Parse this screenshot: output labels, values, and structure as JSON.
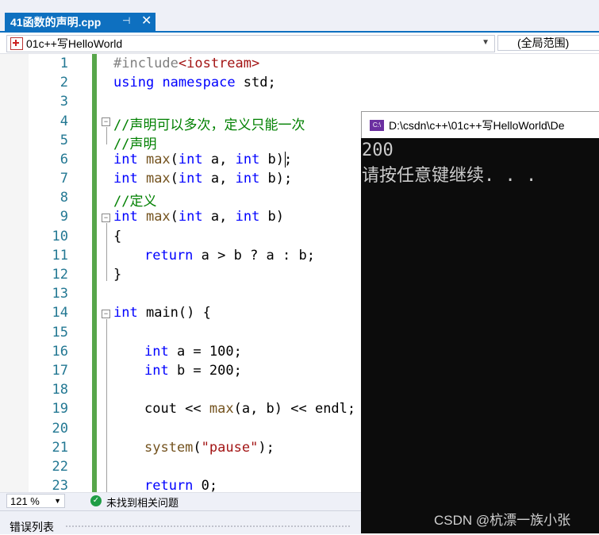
{
  "tab": {
    "title": "41函数的声明.cpp",
    "pin": "⊣",
    "close": "✕"
  },
  "navbar": {
    "project": "01c++写HelloWorld",
    "scope": "(全局范围)"
  },
  "line_numbers": [
    "1",
    "2",
    "3",
    "4",
    "5",
    "6",
    "7",
    "8",
    "9",
    "10",
    "11",
    "12",
    "13",
    "14",
    "15",
    "16",
    "17",
    "18",
    "19",
    "20",
    "21",
    "22",
    "23"
  ],
  "code": {
    "l1_directive": "#include",
    "l1_header": "<iostream>",
    "l2_using": "using",
    "l2_namespace": "namespace",
    "l2_rest": " std;",
    "l4": "//声明可以多次，定义只能一次",
    "l5": "//声明",
    "int_kw": "int",
    "l6_fn": " max",
    "l6_a": "(",
    "l6_b": " a, ",
    "l6_c": " b);",
    "l8": "//定义",
    "l9_c": " b)",
    "l10": "{",
    "l11_return": "return",
    "l11_rest": " a > b ? a : b;",
    "l12": "}",
    "l14_rest": " main() {",
    "l16_rest": " a = 100;",
    "l17_rest": " b = 200;",
    "l19_cout": "cout << ",
    "l19_fn": "max",
    "l19_rest": "(a, b) << endl;",
    "l21_fn": "system",
    "l21_open": "(",
    "l21_str": "\"pause\"",
    "l21_close": ");",
    "l23_return": "return",
    "l23_rest": " 0;"
  },
  "console": {
    "title": "D:\\csdn\\c++\\01c++写HelloWorld\\De",
    "icon": "C:\\",
    "output": [
      "200",
      "请按任意键继续. . ."
    ]
  },
  "status": {
    "zoom": "121 %",
    "issues": "未找到相关问题"
  },
  "error_panel": {
    "title": "错误列表"
  },
  "watermark": "CSDN @杭漂一族小张"
}
